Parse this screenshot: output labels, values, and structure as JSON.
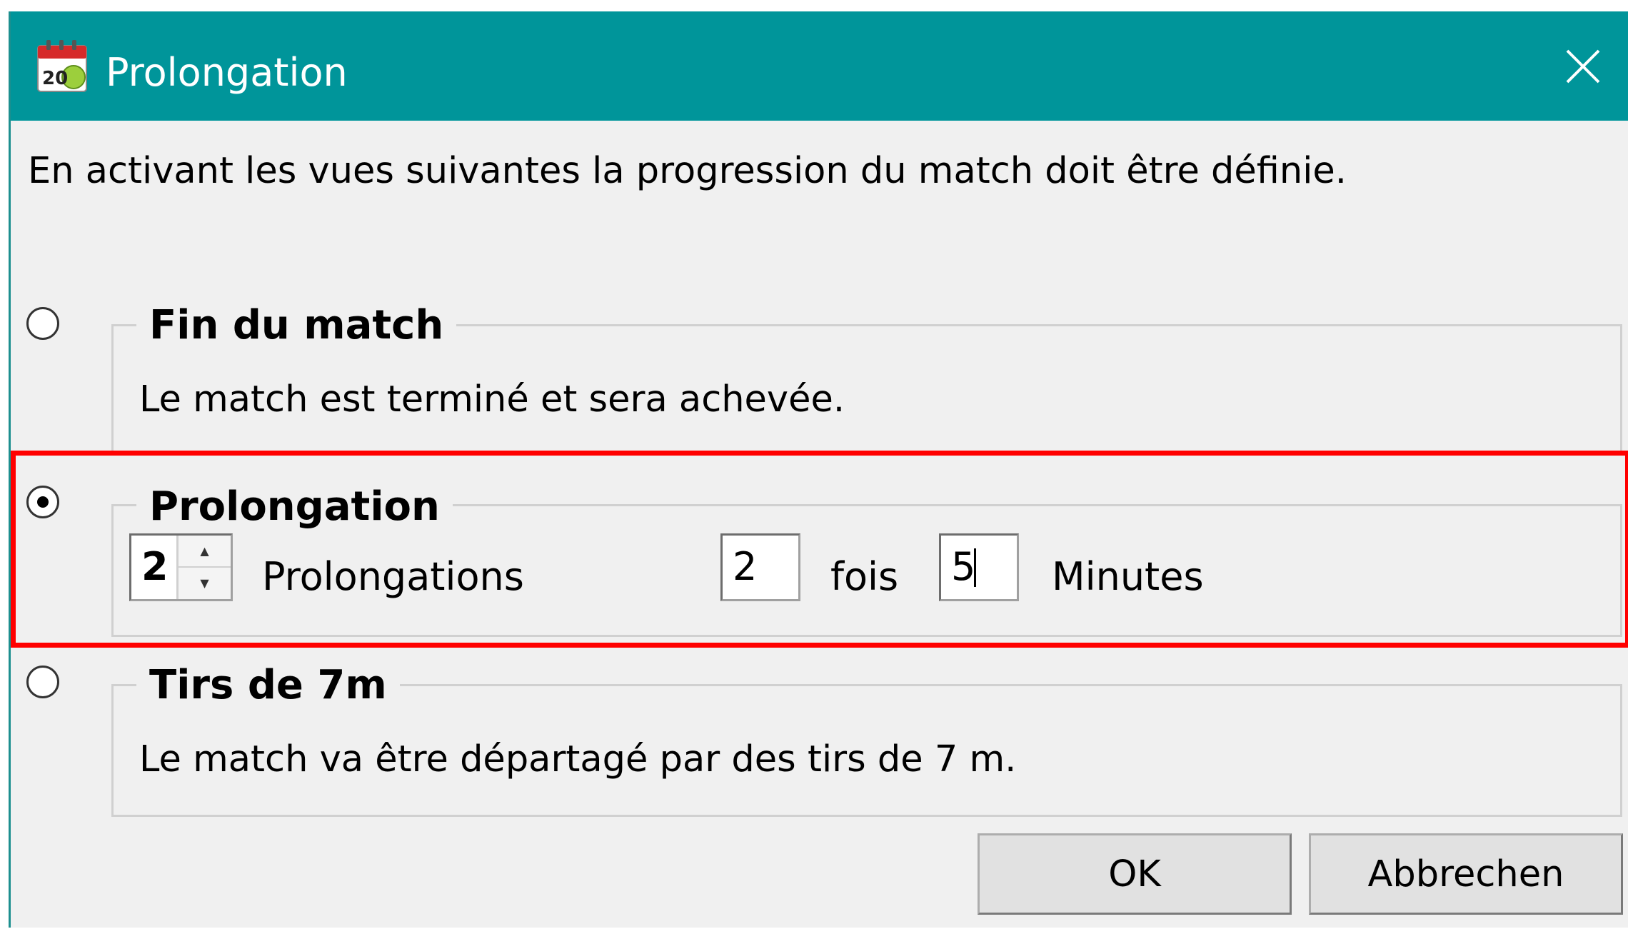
{
  "window": {
    "title": "Prolongation",
    "icon": "calendar-app-icon",
    "icon_number": "20",
    "close_icon": "close-icon",
    "title_bar_color": "#00959a"
  },
  "intro_text": "En activant les vues suivantes la progression du match doit être définie.",
  "options": {
    "end_match": {
      "selected": false,
      "title": "Fin du match",
      "description": "Le match est terminé et sera achevée."
    },
    "overtime": {
      "selected": true,
      "title": "Prolongation",
      "count_value": "2",
      "count_label": "Prolongations",
      "times_value": "2",
      "times_label": "fois",
      "minutes_value": "5",
      "minutes_label": "Minutes"
    },
    "shootout": {
      "selected": false,
      "title": "Tirs de 7m",
      "description": "Le match va être départagé par des tirs de 7 m."
    }
  },
  "highlight_color": "#ff0000",
  "buttons": {
    "ok_label": "OK",
    "cancel_label": "Abbrechen"
  }
}
